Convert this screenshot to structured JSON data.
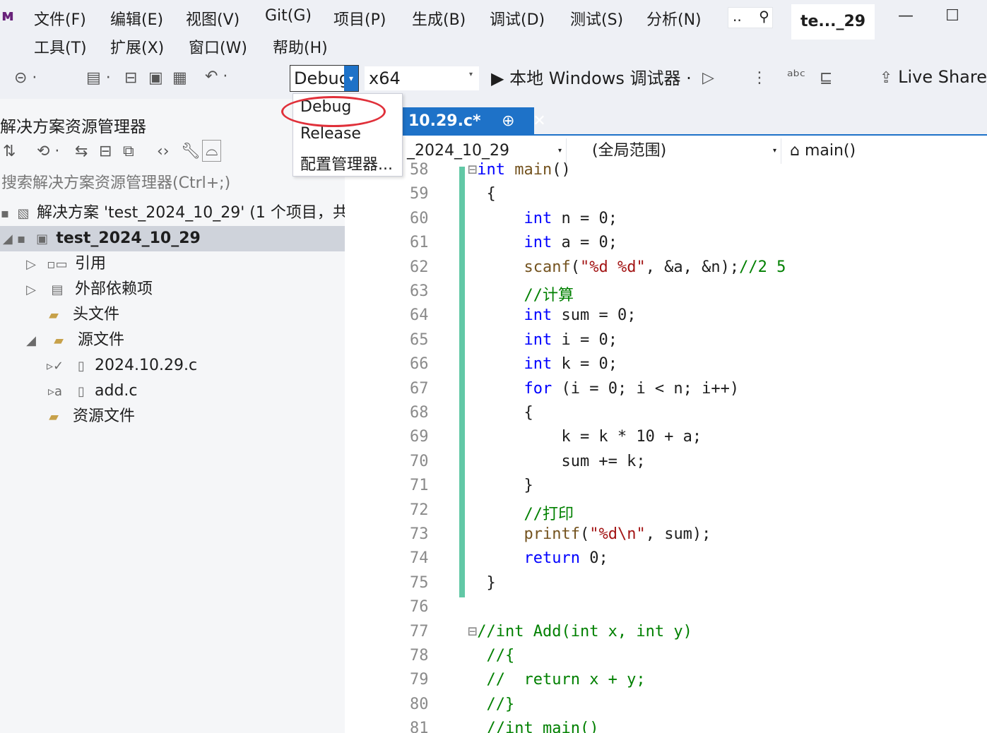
{
  "menu": {
    "row1": [
      "文件(F)",
      "编辑(E)",
      "视图(V)",
      "Git(G)",
      "项目(P)",
      "生成(B)",
      "调试(D)",
      "测试(S)",
      "分析(N)"
    ],
    "row2": [
      "工具(T)",
      "扩展(X)",
      "窗口(W)",
      "帮助(H)"
    ],
    "search_text": "..",
    "solution_badge": "te..._29",
    "minimize": "—",
    "maximize": "☐"
  },
  "toolbar": {
    "config_value": "Debug",
    "platform_value": "x64",
    "debugger_label": "▶ 本地 Windows 调试器 ·",
    "live_share": "Live Share"
  },
  "config_dropdown": {
    "options": [
      "Debug",
      "Release",
      "配置管理器..."
    ]
  },
  "solution_explorer": {
    "title": "解决方案资源管理器",
    "search_placeholder": "搜索解决方案资源管理器(Ctrl+;)",
    "tree": [
      {
        "label": "解决方案 'test_2024_10_29' (1 个项目，共"
      },
      {
        "label": "test_2024_10_29"
      },
      {
        "label": "引用"
      },
      {
        "label": "外部依赖项"
      },
      {
        "label": "头文件"
      },
      {
        "label": "源文件"
      },
      {
        "label": "2024.10.29.c"
      },
      {
        "label": "add.c"
      },
      {
        "label": "资源文件"
      }
    ]
  },
  "editor": {
    "tab_label": "10.29.c*",
    "tab_pin": "⊕",
    "tab_close": "✕",
    "nav_project": "_2024_10_29",
    "nav_scope": "(全局范围)",
    "nav_member": "main()",
    "line_numbers": [
      "58",
      "59",
      "60",
      "61",
      "62",
      "63",
      "64",
      "65",
      "66",
      "67",
      "68",
      "69",
      "70",
      "71",
      "72",
      "73",
      "74",
      "75",
      "76",
      "77",
      "78",
      "79",
      "80",
      "81"
    ],
    "code": [
      "int main()",
      "{",
      "    int n = 0;",
      "    int a = 0;",
      "    scanf(\"%d %d\", &a, &n);//2 5",
      "    //计算",
      "    int sum = 0;",
      "    int i = 0;",
      "    int k = 0;",
      "    for (i = 0; i < n; i++)",
      "    {",
      "        k = k * 10 + a;",
      "        sum += k;",
      "    }",
      "    //打印",
      "    printf(\"%d\\n\", sum);",
      "    return 0;",
      "}",
      "",
      "//int Add(int x, int y)",
      "//{",
      "//  return x + y;",
      "//}",
      "//int main()"
    ]
  },
  "colors": {
    "accent": "#1e72c8",
    "highlight_ellipse": "#e0303a",
    "change_bar": "#62c8a6"
  }
}
